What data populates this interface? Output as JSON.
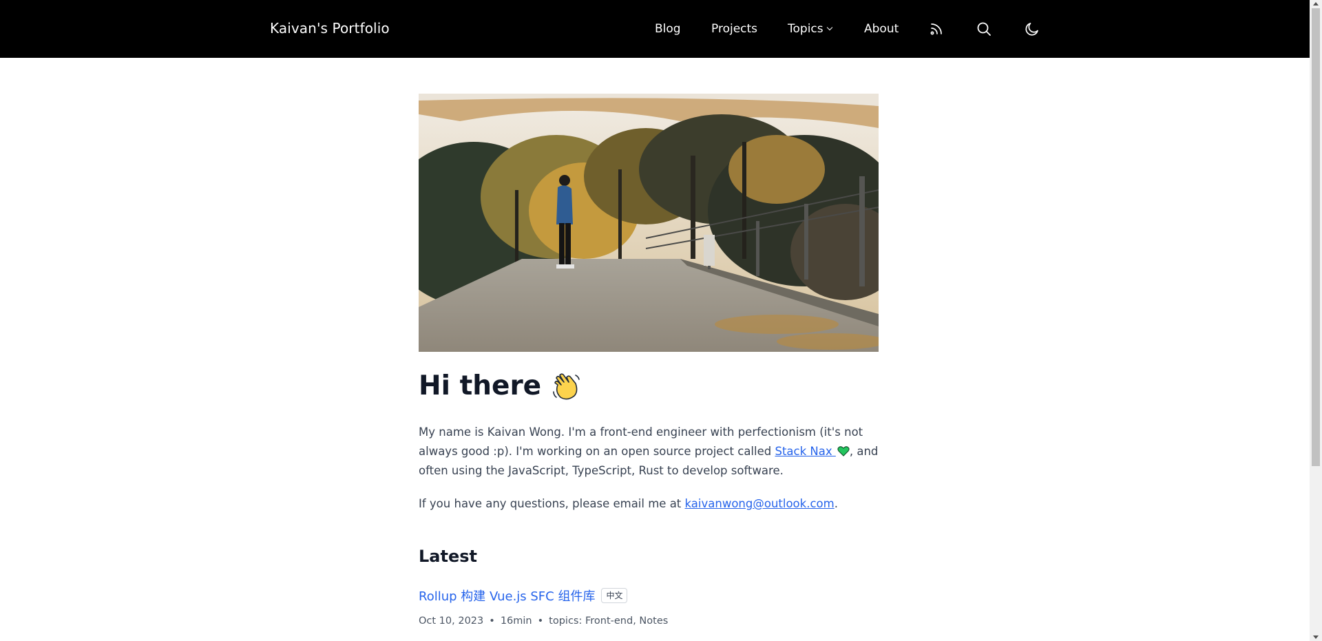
{
  "header": {
    "brand": "Kaivan's Portfolio",
    "nav": {
      "blog": "Blog",
      "projects": "Projects",
      "topics": "Topics",
      "about": "About"
    },
    "icons": [
      "rss-icon",
      "search-icon",
      "moon-icon"
    ]
  },
  "main": {
    "greeting": "Hi there",
    "greeting_emoji": "waving-hand-emoji",
    "intro": {
      "part1": "My name is Kaivan Wong. I'm a front-end engineer with perfectionism (it's not always good :p). I'm working on an open source project called ",
      "link_text": "Stack Nax ",
      "part2": ", and often using the JavaScript, TypeScript, Rust to develop software."
    },
    "contact": {
      "prefix": "If you have any questions, please email me at ",
      "email": "kaivanwong@outlook.com",
      "suffix": "."
    },
    "latest_heading": "Latest",
    "posts": [
      {
        "title": "Rollup 构建 Vue.js SFC 组件库",
        "lang": "中文",
        "date": "Oct 10, 2023",
        "read_time": "16min",
        "topics": "topics: Front-end, Notes"
      }
    ]
  },
  "colors": {
    "header_bg": "#000000",
    "link": "#2563eb",
    "heading": "#111827",
    "body_text": "#374151"
  }
}
